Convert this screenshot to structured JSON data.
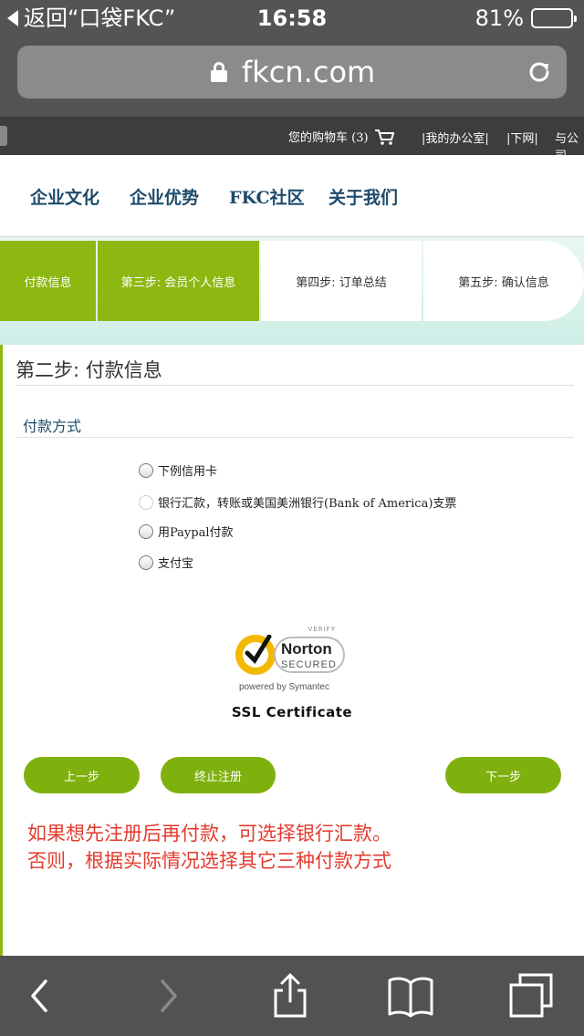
{
  "status_bar": {
    "back_label": "返回“口袋FKC”",
    "time": "16:58",
    "battery": "81%",
    "battery_level": 0.81
  },
  "address_bar": {
    "url": "fkcn.com"
  },
  "site_topbar": {
    "cart_label": "您的购物车 (3)",
    "links": [
      "|我的办公室|",
      "|下网|",
      "与公司"
    ]
  },
  "nav": {
    "items": [
      "企业文化",
      "企业优势",
      "FKC社区",
      "关于我们"
    ]
  },
  "steps": [
    {
      "label": "付款信息",
      "state": "done"
    },
    {
      "label": "第三步: 会员个人信息",
      "state": "done"
    },
    {
      "label": "第四步: 订单总结",
      "state": "todo"
    },
    {
      "label": "第五步: 确认信息",
      "state": "todo"
    }
  ],
  "form": {
    "title": "第二步: 付款信息",
    "section_title": "付款方式",
    "options": [
      "下例信用卡",
      "银行汇款，转账或美国美洲银行(Bank of America)支票",
      "用Paypal付款",
      "支付宝"
    ],
    "norton": {
      "verify": "VERIFY",
      "brand": "Norton",
      "secured": "SECURED",
      "powered": "powered by Symantec"
    },
    "ssl_label": "SSL Certificate",
    "buttons": {
      "prev": "上一步",
      "stop": "终止注册",
      "next": "下一步"
    },
    "note_lines": [
      "如果想先注册后再付款，可选择银行汇款。",
      "否则，根据实际情况选择其它三种付款方式"
    ]
  },
  "colors": {
    "accent_green": "#8db812",
    "nav_blue": "#1e4b6b",
    "note_red": "#e33b2e"
  }
}
